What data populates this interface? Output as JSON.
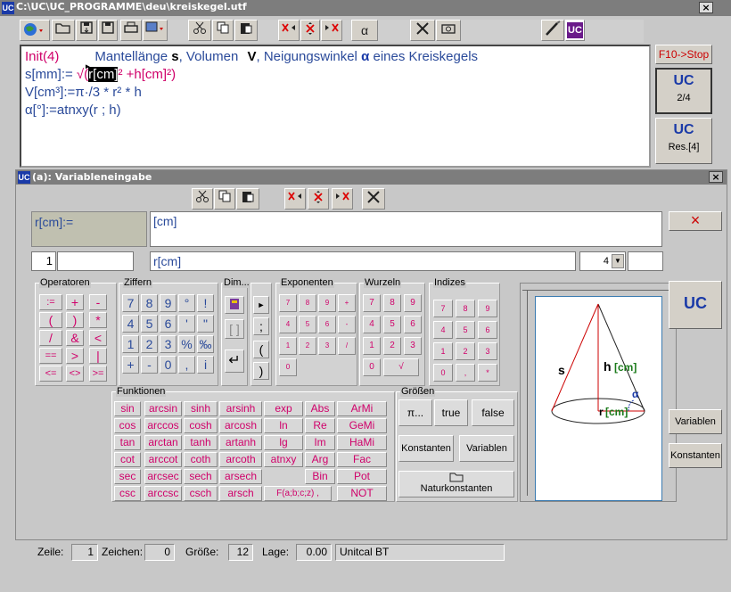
{
  "main_window": {
    "app_icon": "UC",
    "title": "C:\\UC\\UC_PROGRAMME\\deu\\kreiskegel.utf",
    "close": "×"
  },
  "toolbar": {
    "alpha_label": "α"
  },
  "editor": {
    "line1": {
      "init": "Init(4)",
      "rest1": "Mantellänge",
      "s": "s",
      "rest2": ", Volumen",
      "v": "V",
      "rest3": ", Neigungswinkel",
      "a": "α",
      "rest4": "eines Kreiskegels"
    },
    "line2": {
      "pre": "s[mm]:= ",
      "sqrt": "√(",
      "sel": "r[cm]",
      "post": "² +h[cm]²)"
    },
    "line3": "V[cm³]:=π·/3 * r² * h",
    "line4": "α[°]:=atnxy(r ; h)"
  },
  "right_panel": {
    "stop_label": "F10->Stop",
    "page": "2/4",
    "res_label": "Res.[4]",
    "uc_icon": "UC"
  },
  "dialog": {
    "app_icon": "UC",
    "title": "(a): Variableneingabe",
    "close": "×",
    "var_label": "r[cm]:=",
    "var_value": "[cm]",
    "index_value": "1",
    "unit_field": "r[cm]",
    "precision": "4",
    "cancel": "×"
  },
  "groups": {
    "operatoren": {
      "label": "Operatoren",
      "keys": [
        ":=",
        "+",
        "-",
        "(",
        ")",
        "*",
        "/",
        "&",
        "<",
        "==",
        ">",
        "|",
        "<=",
        "<>",
        ">="
      ]
    },
    "ziffern": {
      "label": "Ziffern",
      "keys": [
        "7",
        "8",
        "9",
        "°",
        "!",
        "4",
        "5",
        "6",
        "'",
        "\"",
        "1",
        "2",
        "3",
        "%",
        "‰",
        "+",
        "-",
        "0",
        ",",
        "i"
      ]
    },
    "dim": {
      "label": "Dim...",
      "keys": [
        "[ ]",
        "↵"
      ]
    },
    "seps": {
      "keys": [
        "►",
        ";",
        "(",
        ")"
      ]
    },
    "exponenten": {
      "label": "Exponenten",
      "keys": [
        "7",
        "8",
        "9",
        "+",
        "4",
        "5",
        "6",
        "-",
        "1",
        "2",
        "3",
        "/",
        "0"
      ]
    },
    "wurzeln": {
      "label": "Wurzeln",
      "keys": [
        "7",
        "8",
        "9",
        "4",
        "5",
        "6",
        "1",
        "2",
        "3",
        "0",
        "√"
      ]
    },
    "indizes": {
      "label": "Indizes",
      "keys": [
        "7",
        "8",
        "9",
        "4",
        "5",
        "6",
        "1",
        "2",
        "3",
        "0",
        ",",
        "*"
      ]
    },
    "funktionen": {
      "label": "Funktionen",
      "rows": [
        [
          "sin",
          "arcsin",
          "sinh",
          "arsinh",
          "exp",
          "Abs",
          "ArMi"
        ],
        [
          "cos",
          "arccos",
          "cosh",
          "arcosh",
          "ln",
          "Re",
          "GeMi"
        ],
        [
          "tan",
          "arctan",
          "tanh",
          "artanh",
          "lg",
          "Im",
          "HaMi"
        ],
        [
          "cot",
          "arccot",
          "coth",
          "arcoth",
          "atnxy",
          "Arg",
          "Fac"
        ],
        [
          "sec",
          "arcsec",
          "sech",
          "arsech",
          "",
          "Bin",
          "Pot"
        ],
        [
          "csc",
          "arccsc",
          "csch",
          "arsch",
          "F(a;b;c;z) ,",
          "",
          "NOT"
        ]
      ]
    },
    "groessen": {
      "label": "Größen",
      "pi": "π...",
      "true": "true",
      "false": "false",
      "konstanten": "Konstanten",
      "variablen": "Variablen",
      "naturkonstanten": "Naturkonstanten"
    }
  },
  "figure": {
    "s": "s",
    "h": "h",
    "h_unit": "[cm]",
    "r": "r",
    "r_unit": "[cm]",
    "alpha": "α"
  },
  "side_buttons": {
    "variablen": "Variablen",
    "konstanten": "Konstanten"
  },
  "statusbar": {
    "zeile_label": "Zeile:",
    "zeile": "1",
    "zeichen_label": "Zeichen:",
    "zeichen": "0",
    "groesse_label": "Größe:",
    "groesse": "12",
    "lage_label": "Lage:",
    "lage": "0.00",
    "font": "Unitcal BT"
  }
}
